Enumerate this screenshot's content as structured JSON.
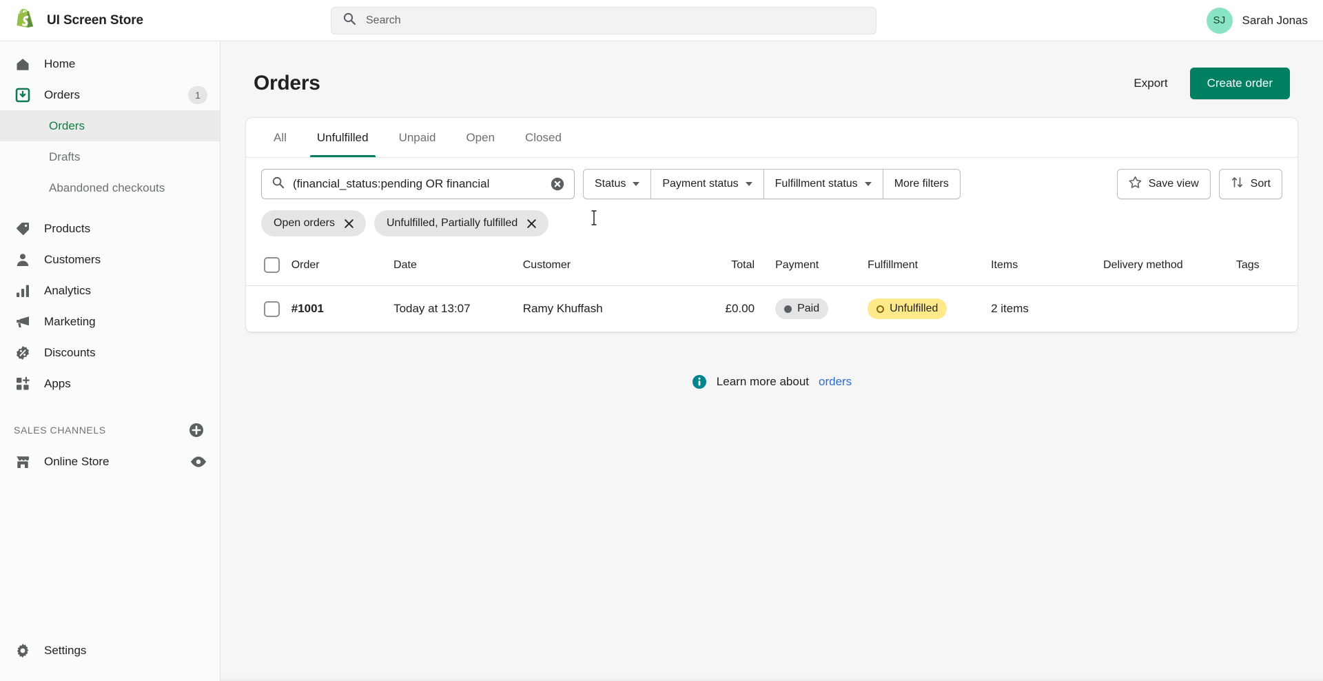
{
  "topbar": {
    "brand_name": "UI Screen Store",
    "logo_icon": "shopify-bag-icon",
    "search_icon": "search-icon",
    "search_placeholder": "Search",
    "search_value": "",
    "user_initials": "SJ",
    "user_name": "Sarah Jonas",
    "avatar_color": "#8ae3c2"
  },
  "sidebar": {
    "items": [
      {
        "label": "Home",
        "icon": "home-icon",
        "badge": ""
      },
      {
        "label": "Orders",
        "icon": "orders-inbox-icon",
        "badge": "1"
      },
      {
        "label": "Products",
        "icon": "tag-icon",
        "badge": ""
      },
      {
        "label": "Customers",
        "icon": "person-icon",
        "badge": ""
      },
      {
        "label": "Analytics",
        "icon": "bar-chart-icon",
        "badge": ""
      },
      {
        "label": "Marketing",
        "icon": "megaphone-icon",
        "badge": ""
      },
      {
        "label": "Discounts",
        "icon": "discount-percent-icon",
        "badge": ""
      },
      {
        "label": "Apps",
        "icon": "apps-grid-plus-icon",
        "badge": ""
      }
    ],
    "orders_subnav": [
      {
        "label": "Orders",
        "active": true
      },
      {
        "label": "Drafts",
        "active": false
      },
      {
        "label": "Abandoned checkouts",
        "active": false
      }
    ],
    "sales_channels": {
      "title": "SALES CHANNELS",
      "add_icon": "plus-circle-icon",
      "items": [
        {
          "label": "Online Store",
          "icon": "storefront-icon",
          "trailing_icon": "eye-icon"
        }
      ]
    },
    "settings": {
      "label": "Settings",
      "icon": "gear-icon"
    },
    "active_color": "#108043"
  },
  "page": {
    "title": "Orders",
    "export_label": "Export",
    "create_order_label": "Create order",
    "primary_color": "#008060"
  },
  "tabs": [
    {
      "label": "All",
      "active": false
    },
    {
      "label": "Unfulfilled",
      "active": true
    },
    {
      "label": "Unpaid",
      "active": false
    },
    {
      "label": "Open",
      "active": false
    },
    {
      "label": "Closed",
      "active": false
    }
  ],
  "filters": {
    "search_icon": "search-icon",
    "search_value": "(financial_status:pending OR financial",
    "search_placeholder": "Filter orders",
    "clear_icon": "clear-circle-icon",
    "buttons": [
      {
        "label": "Status",
        "caret": true
      },
      {
        "label": "Payment status",
        "caret": true
      },
      {
        "label": "Fulfillment status",
        "caret": true
      },
      {
        "label": "More filters",
        "caret": false
      }
    ],
    "save_view_label": "Save view",
    "save_view_icon": "star-icon",
    "sort_label": "Sort",
    "sort_icon": "sort-arrows-icon",
    "chips": [
      {
        "label": "Open orders",
        "remove_icon": "close-icon"
      },
      {
        "label": "Unfulfilled, Partially fulfilled",
        "remove_icon": "close-icon"
      }
    ]
  },
  "table": {
    "columns": [
      "Order",
      "Date",
      "Customer",
      "Total",
      "Payment",
      "Fulfillment",
      "Items",
      "Delivery method",
      "Tags"
    ],
    "rows": [
      {
        "order": "#1001",
        "date": "Today at 13:07",
        "customer": "Ramy Khuffash",
        "total": "£0.00",
        "payment": "Paid",
        "fulfillment": "Unfulfilled",
        "items": "2 items",
        "delivery_method": "",
        "tags": ""
      }
    ]
  },
  "footer": {
    "info_icon": "info-circle-icon",
    "text": "Learn more about",
    "link_text": "orders",
    "link_color": "#2c6ecb"
  }
}
